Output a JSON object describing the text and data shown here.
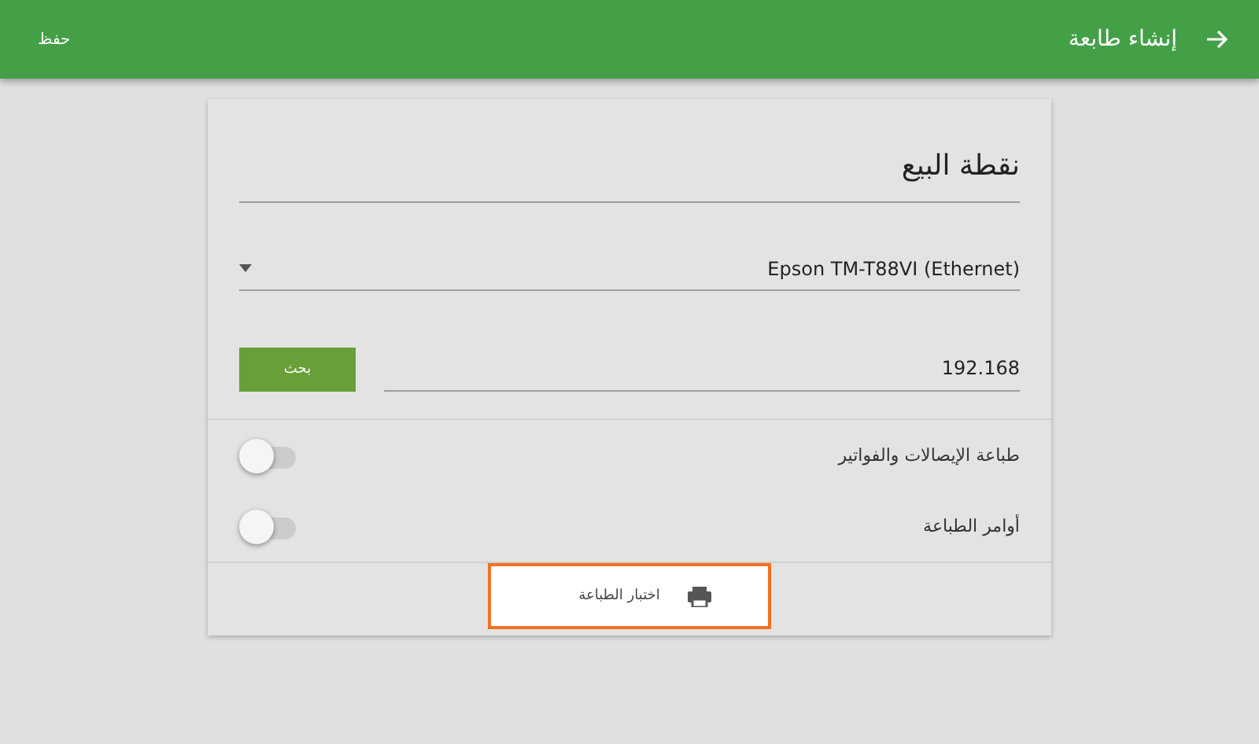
{
  "app_bar": {
    "title": "إنشاء طابعة",
    "save": "حفظ"
  },
  "form": {
    "name_value": "نقطة البيع",
    "model_value": "Epson TM-T88VI (Ethernet)",
    "address_value": "192.168",
    "search_button": "بحث",
    "toggles": [
      {
        "label": "طباعة الإيصالات والفواتير",
        "on": false
      },
      {
        "label": "أوامر الطباعة",
        "on": false
      }
    ],
    "test_button": {
      "label": "اختبار الطباعة",
      "highlighted": true
    }
  }
}
